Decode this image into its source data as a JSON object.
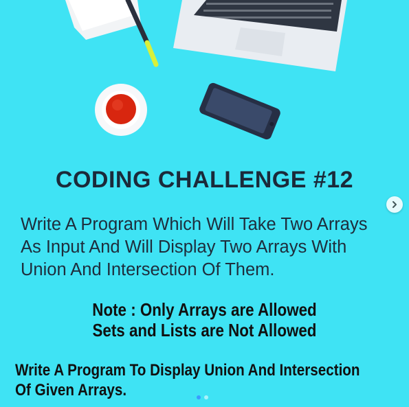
{
  "post": {
    "title": "CODING CHALLENGE #12",
    "description_lines": [
      "Write A Program Which Will Take Two Arrays",
      "As Input And Will Display Two Arrays With",
      "Union And Intersection Of Them."
    ],
    "note_lines": [
      "Note : Only Arrays are Allowed",
      "Sets and Lists are Not Allowed"
    ],
    "task_lines": [
      "Write A Program To Display Union And Intersection",
      "Of Given Arrays."
    ]
  },
  "carousel": {
    "total_slides": 2,
    "active_slide": 1,
    "next_icon": "chevron-right-icon"
  },
  "colors": {
    "background": "#3fe3f4",
    "title_text": "#1b2a3a",
    "body_text": "#1e2d3c",
    "note_text": "#101010",
    "active_dot": "#3b9bff"
  }
}
